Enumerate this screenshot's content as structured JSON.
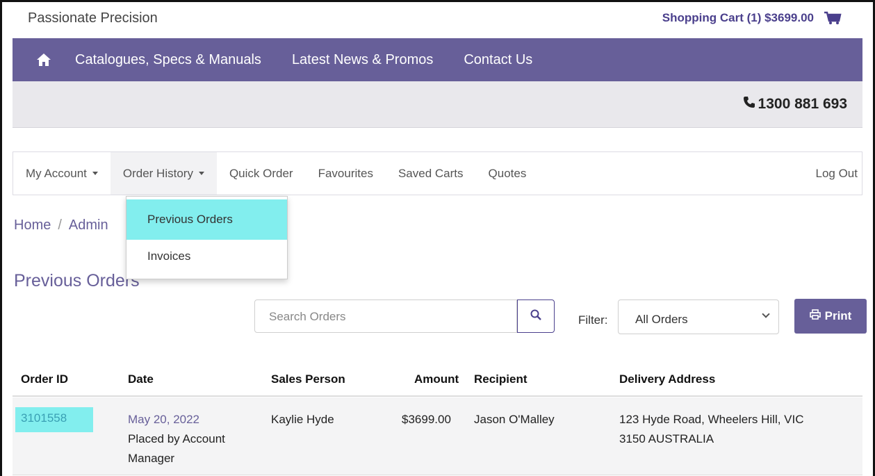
{
  "header": {
    "brand": "Passionate Precision",
    "cart_label": "Shopping Cart (1) $3699.00"
  },
  "main_nav": {
    "items": [
      {
        "label": "Catalogues, Specs & Manuals"
      },
      {
        "label": "Latest News & Promos"
      },
      {
        "label": "Contact Us"
      }
    ]
  },
  "phone": "1300 881 693",
  "account_nav": {
    "items": [
      {
        "label": "My Account"
      },
      {
        "label": "Order History"
      },
      {
        "label": "Quick Order"
      },
      {
        "label": "Favourites"
      },
      {
        "label": "Saved Carts"
      },
      {
        "label": "Quotes"
      }
    ],
    "logout": "Log Out"
  },
  "dropdown": {
    "items": [
      {
        "label": "Previous Orders"
      },
      {
        "label": "Invoices"
      }
    ]
  },
  "breadcrumb": {
    "home": "Home",
    "sep": "/",
    "current": "Admin"
  },
  "page_title": "Previous Orders",
  "search": {
    "placeholder": "Search Orders"
  },
  "filter": {
    "label": "Filter:",
    "selected": "All Orders"
  },
  "print_label": "Print",
  "table": {
    "headers": [
      "Order ID",
      "Date",
      "Sales Person",
      "Amount",
      "Recipient",
      "Delivery Address"
    ],
    "rows": [
      {
        "order_id": "3101558",
        "date": "May 20, 2022",
        "placed_by": "Placed by Account",
        "placed_by_2": "Manager",
        "sales_person": "Kaylie Hyde",
        "amount": "$3699.00",
        "recipient": "Jason O'Malley",
        "address_1": "123 Hyde Road, Wheelers Hill, VIC",
        "address_2": "3150 AUSTRALIA"
      }
    ]
  },
  "colors": {
    "brand_purple": "#675f99",
    "highlight_cyan": "#82eeee"
  },
  "icons": [
    "home-icon",
    "cart-icon",
    "phone-icon",
    "search-icon",
    "print-icon"
  ]
}
